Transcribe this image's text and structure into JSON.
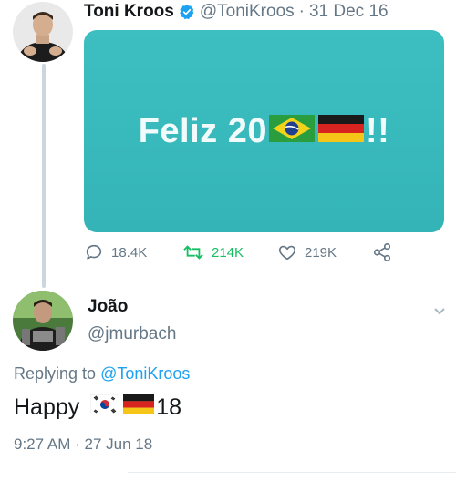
{
  "tweet1": {
    "name": "Toni Kroos",
    "handle": "@ToniKroos",
    "separator": "·",
    "date": "31 Dec 16",
    "image_text": "Feliz 20",
    "image_suffix": "!!",
    "stats": {
      "replies": "18.4K",
      "retweets": "214K",
      "likes": "219K"
    }
  },
  "tweet2": {
    "name": "João",
    "handle": "@jmurbach",
    "replying_prefix": "Replying to",
    "replying_handle": "@ToniKroos",
    "text_prefix": "Happy",
    "text_suffix": "18",
    "time": "9:27 AM",
    "separator": "·",
    "date": "27 Jun 18"
  },
  "icons": {
    "verified": "verified-badge-icon",
    "reply": "reply-icon",
    "retweet": "retweet-icon",
    "like": "heart-icon",
    "share": "share-icon",
    "more": "chevron-down-icon"
  },
  "colors": {
    "accent": "#1da1f2",
    "retweet": "#17bf63",
    "muted": "#657786",
    "card": "#3dbfc1"
  }
}
